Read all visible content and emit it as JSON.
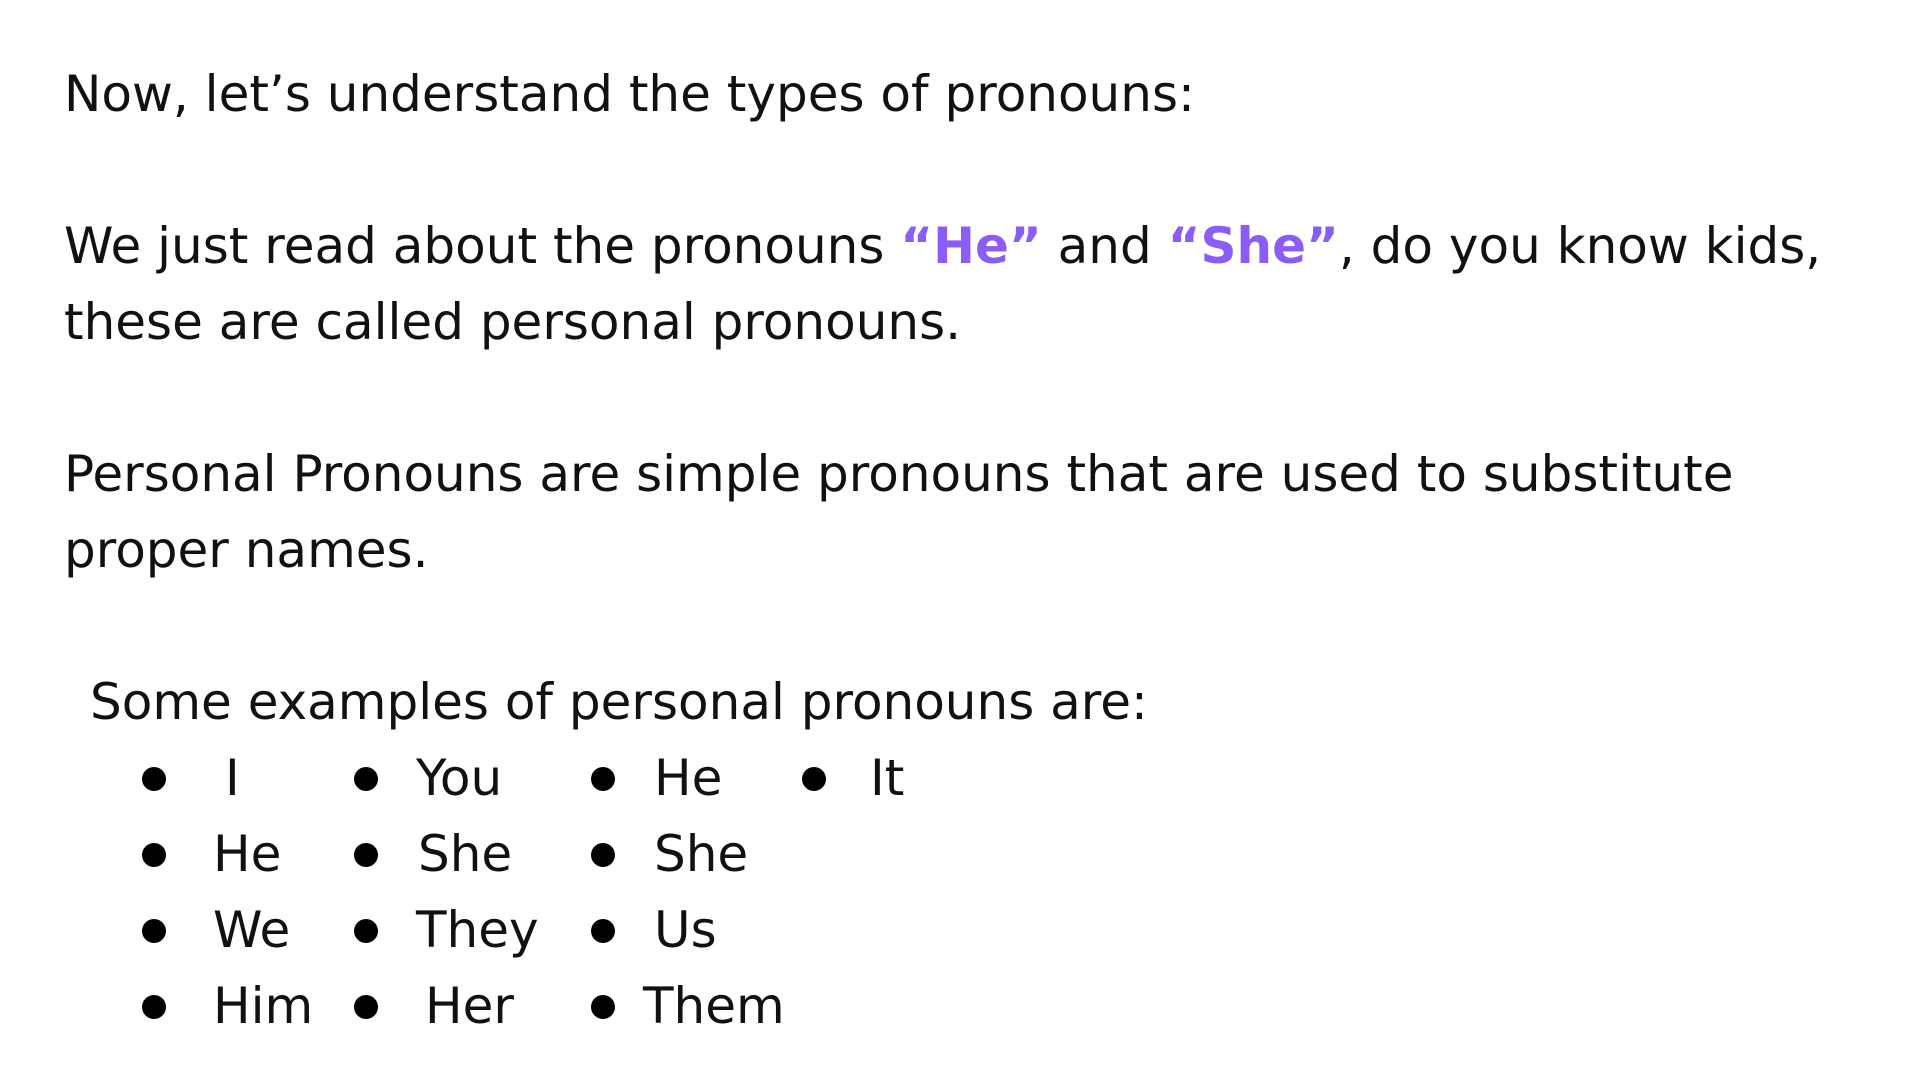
{
  "intro": {
    "text": "Now, let’s understand the types of pronouns:"
  },
  "personal": {
    "before": "We just read about the pronouns ",
    "he_quote": "“He”",
    "and": " and ",
    "she_quote": "“She”",
    "after_line1": ", do you know kids,",
    "line2": "these are called personal pronouns.",
    "highlight_color": "#8b5cf6"
  },
  "definition": {
    "line1": "Personal Pronouns are simple pronouns that are used to substitute",
    "line2": "proper names."
  },
  "examples": {
    "heading": "Some examples of personal pronouns are:",
    "columns": [
      [
        "I",
        "He",
        "We",
        "Him"
      ],
      [
        "You",
        "She",
        "They",
        "Her"
      ],
      [
        "He",
        "She",
        "Us",
        "Them"
      ],
      [
        "It"
      ]
    ]
  }
}
